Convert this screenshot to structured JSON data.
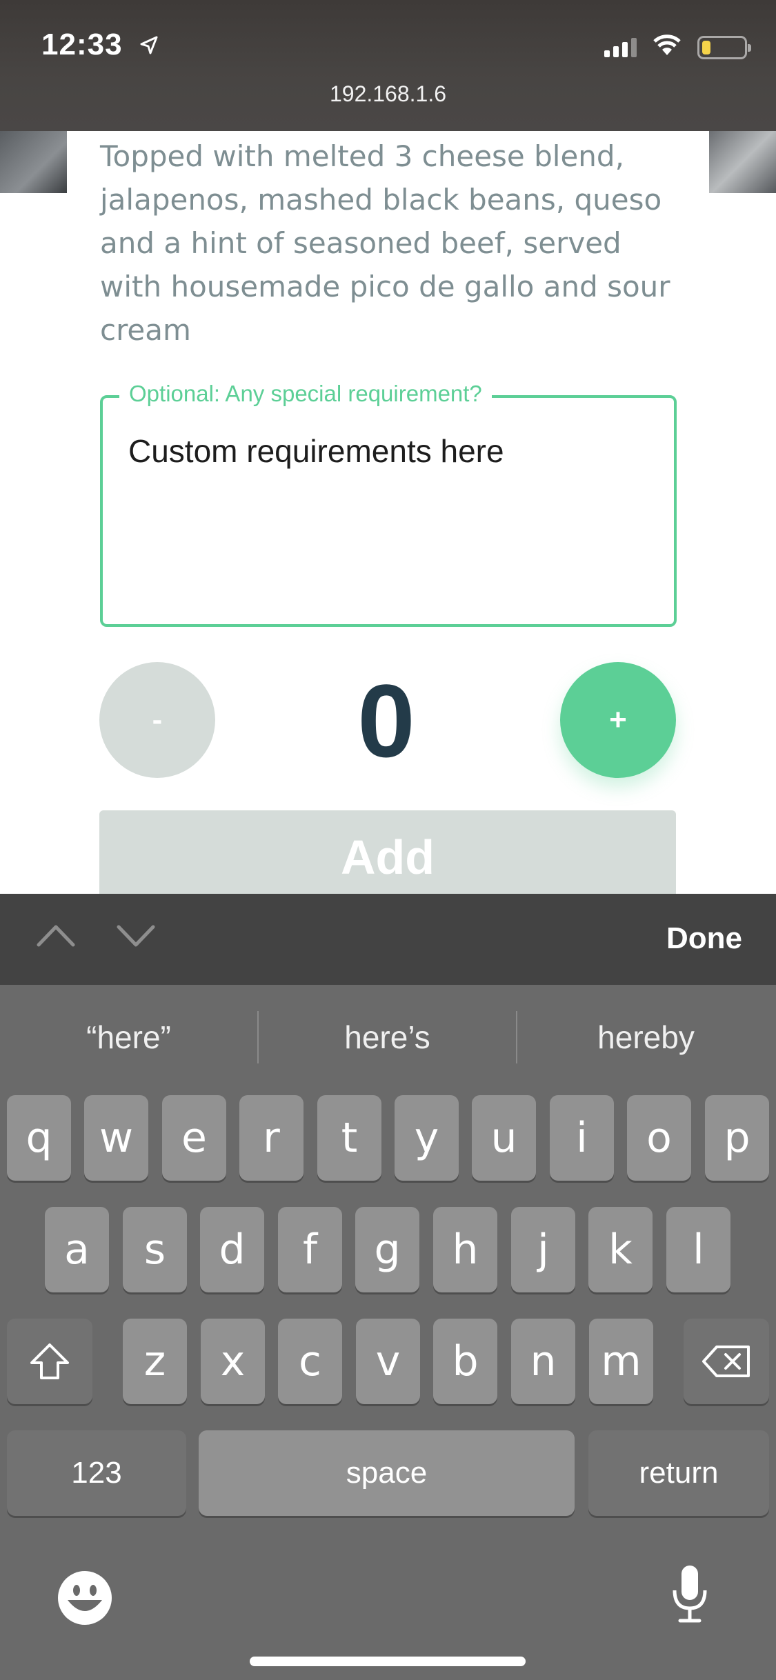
{
  "status_bar": {
    "time": "12:33",
    "url": "192.168.1.6",
    "battery_level": 0.2,
    "signal_bars": 3
  },
  "item": {
    "description": "Topped with melted 3 cheese blend, jalapenos, mashed black beans, queso and a hint of seasoned beef, served with housemade pico de gallo and sour cream"
  },
  "requirements": {
    "label": "Optional: Any special requirement?",
    "value": "Custom requirements here"
  },
  "quantity": {
    "minus_label": "-",
    "plus_label": "+",
    "value": "0"
  },
  "add_button": {
    "label": "Add"
  },
  "accessory_bar": {
    "done_label": "Done",
    "prev_icon": "chevron-up-icon",
    "next_icon": "chevron-down-icon"
  },
  "keyboard": {
    "suggestions": [
      "“here”",
      "here’s",
      "hereby"
    ],
    "rows": [
      [
        "q",
        "w",
        "e",
        "r",
        "t",
        "y",
        "u",
        "i",
        "o",
        "p"
      ],
      [
        "a",
        "s",
        "d",
        "f",
        "g",
        "h",
        "j",
        "k",
        "l"
      ],
      [
        "z",
        "x",
        "c",
        "v",
        "b",
        "n",
        "m"
      ]
    ],
    "numbers_label": "123",
    "space_label": "space",
    "return_label": "return"
  },
  "colors": {
    "accent": "#5ccf96",
    "muted_button": "#d5dcd9",
    "quantity_text": "#233b49",
    "description_text": "#7e8e92"
  }
}
